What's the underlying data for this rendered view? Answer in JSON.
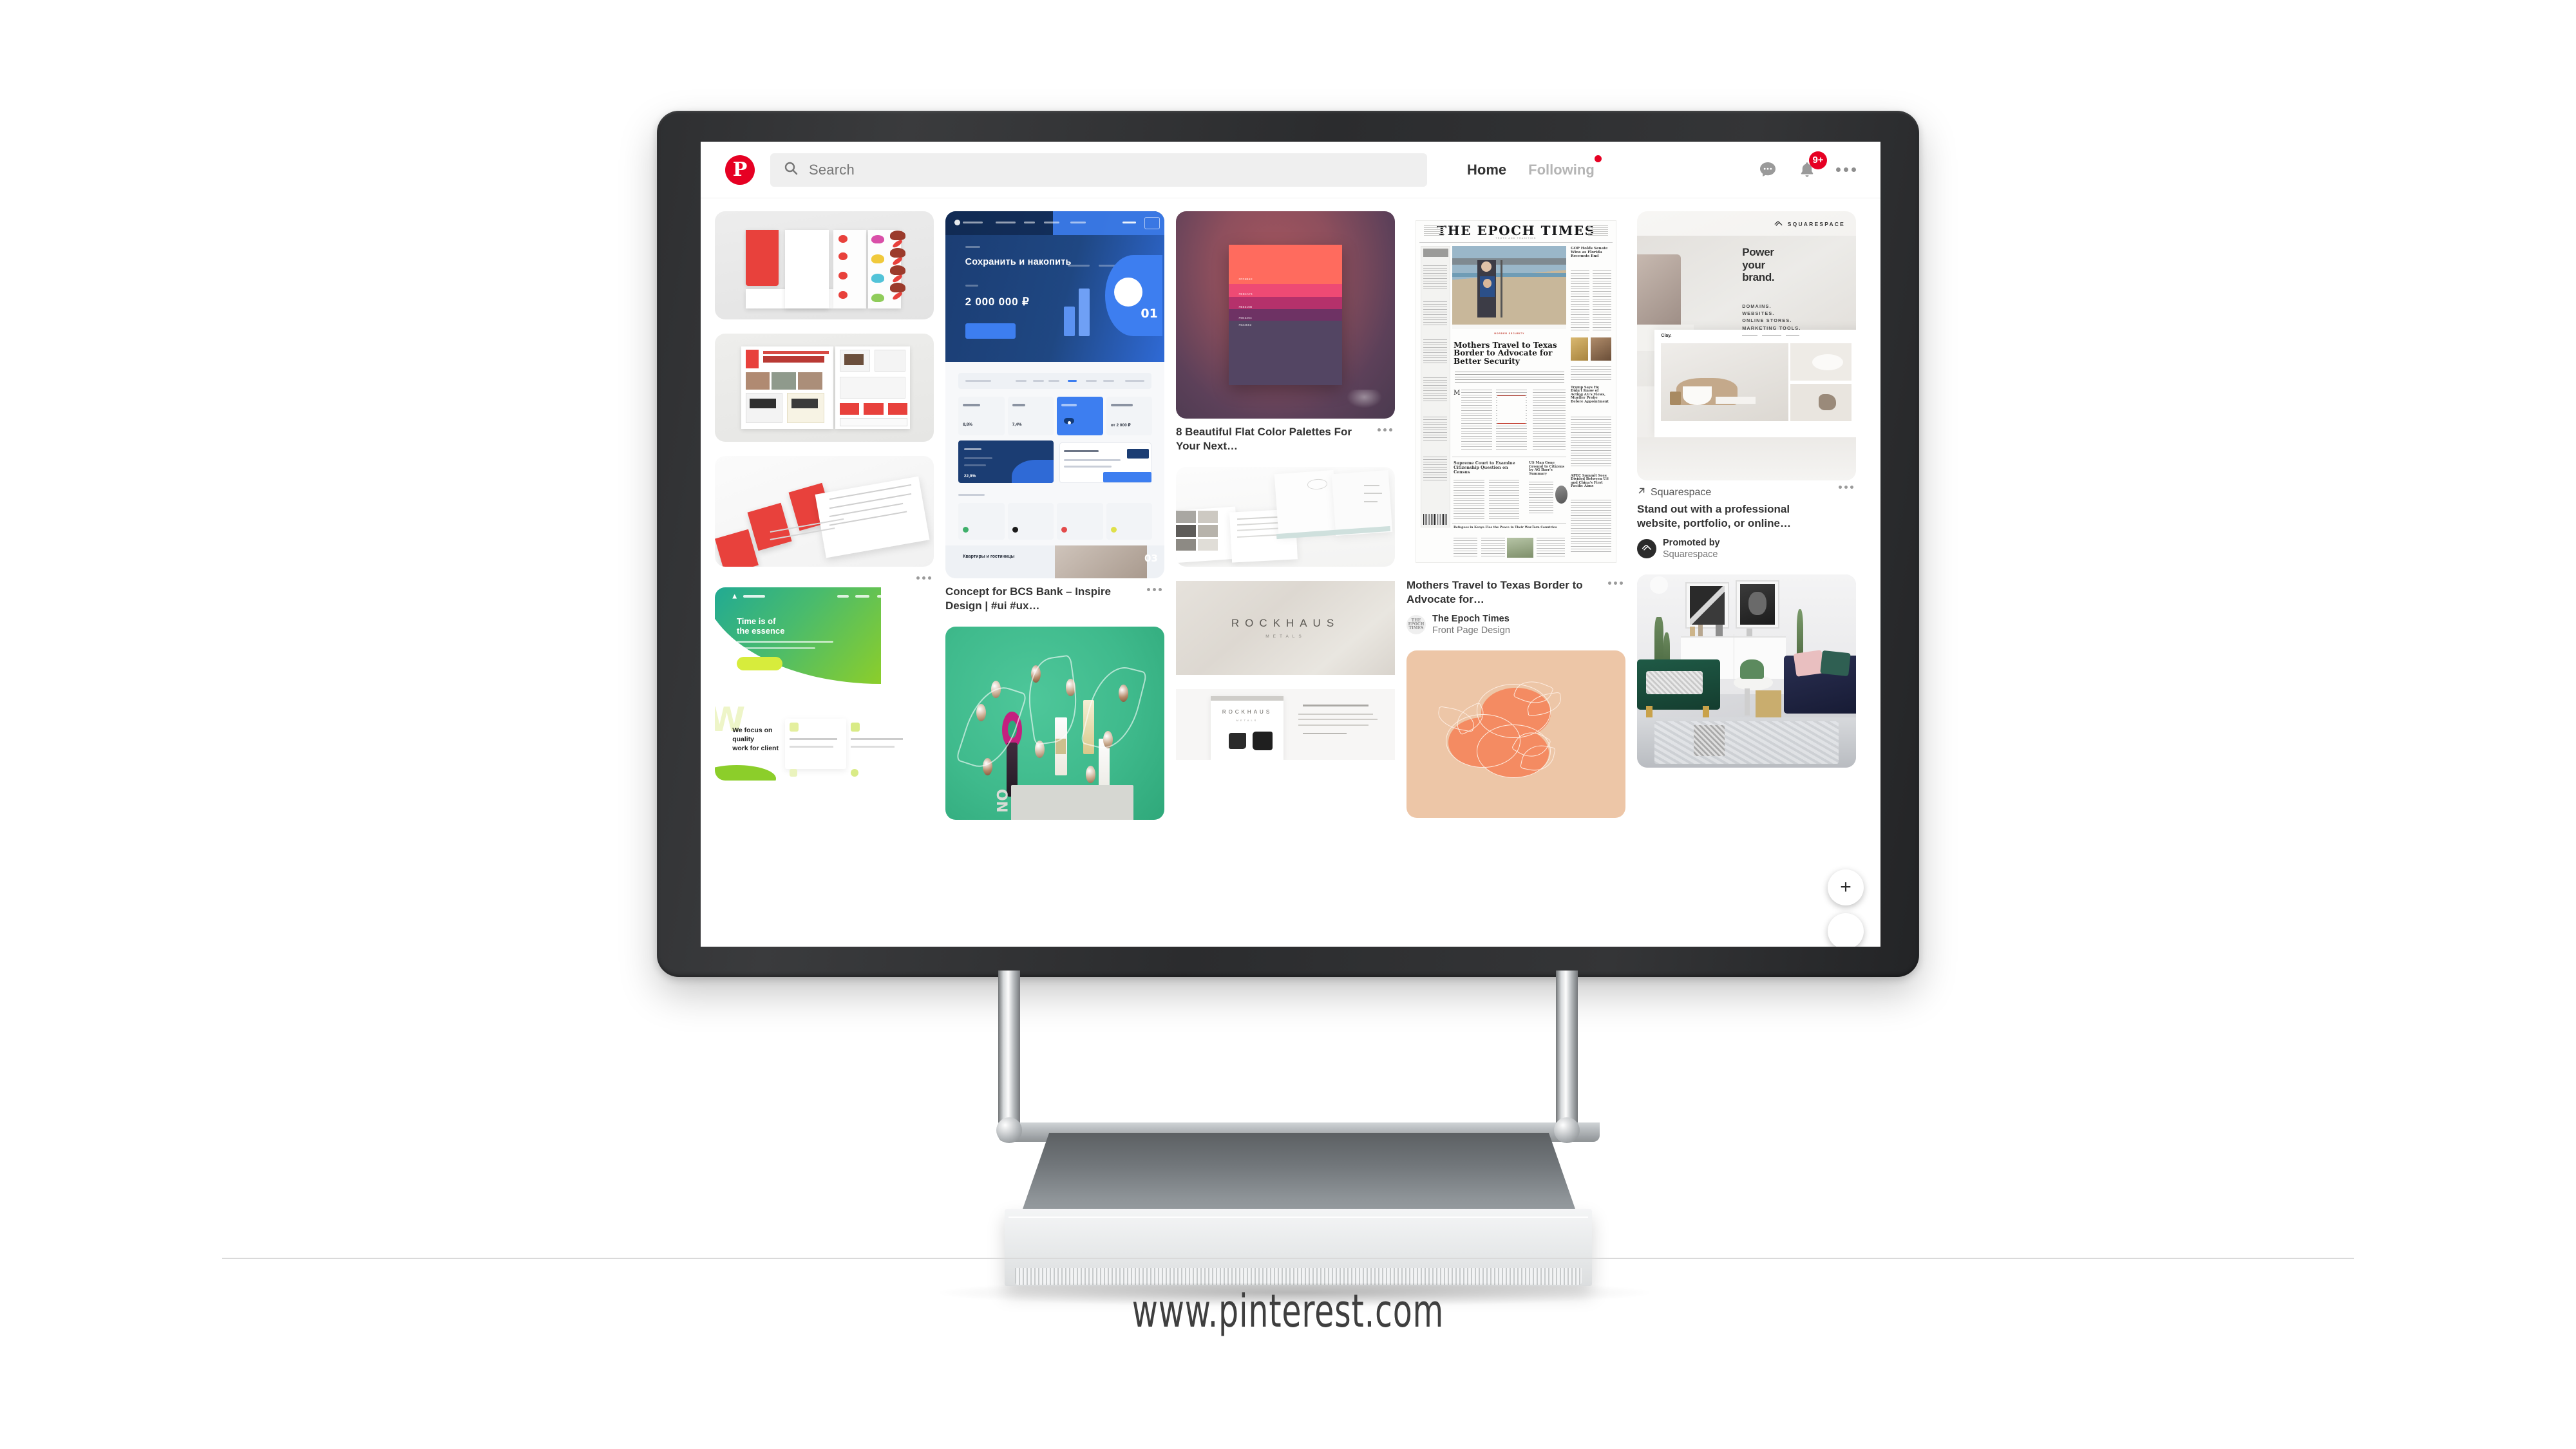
{
  "footer": {
    "url": "www.pinterest.com"
  },
  "browser": {
    "header": {
      "logo_icon": "pinterest-logo-icon",
      "logo_glyph": "P",
      "search": {
        "icon": "search-icon",
        "placeholder": "Search",
        "value": ""
      },
      "nav": [
        {
          "label": "Home",
          "active": true,
          "badge": false
        },
        {
          "label": "Following",
          "active": false,
          "badge": true
        }
      ],
      "actions": [
        {
          "name": "messages-icon",
          "label": "Messages",
          "badge": ""
        },
        {
          "name": "notifications-bell-icon",
          "label": "Notifications",
          "badge": "9+"
        },
        {
          "name": "more-options-icon",
          "label": "More",
          "badge": ""
        }
      ]
    },
    "fabs": [
      {
        "name": "add-pin-fab",
        "glyph": "+"
      },
      {
        "name": "secondary-fab",
        "glyph": ""
      }
    ],
    "feed": {
      "columns": [
        {
          "pins": [
            {
              "id": "matsu-red-family-1",
              "art": "jp-brochure-spread",
              "title": "",
              "kebab": false
            },
            {
              "id": "matsu-red-family-2",
              "art": "jp-brochure-open",
              "title": "",
              "kebab": false
            },
            {
              "id": "matsu-red-family-3",
              "art": "jp-cards-scatter",
              "title": "",
              "kebab": true
            },
            {
              "id": "green-agency-site",
              "art": "agency-green-landing",
              "hero_line1": "Time is of",
              "hero_line2": "the essence",
              "sub_line1": "We focus on",
              "sub_line2": "quality",
              "sub_line3": "work for client",
              "title": "",
              "kebab": false
            }
          ]
        },
        {
          "pins": [
            {
              "id": "bcs-bank-concept",
              "art": "bcs-bank-ui",
              "hero_label": "Сохранить и накопить",
              "hero_amount": "2 000 000 ₽",
              "hero_num": "01",
              "section_num": "03",
              "dates": [
                "28.08",
                "26.08",
                "08.07"
              ],
              "rates": [
                "8,8%",
                "7,4%",
                "от 2 000 ₽",
                "22,9%"
              ],
              "card_title": "Квартиры и гостиницы",
              "title": "Concept for BCS Bank – Inspire Design | #ui #ux…",
              "kebab": true
            },
            {
              "id": "mint-cosmetics-flatlay",
              "art": "mint-flatlay",
              "title": "",
              "kebab": false
            }
          ]
        },
        {
          "pins": [
            {
              "id": "flat-color-palettes",
              "art": "color-palette-card",
              "swatches": [
                "#ff6b5e",
                "#ee4a74",
                "#b5316b",
                "#6e3264",
                "#534563"
              ],
              "hex_labels": [
                "#FF6B5E",
                "#EE4A74",
                "#B5316B",
                "#6E3264",
                "#534563"
              ],
              "title": "8 Beautiful Flat Color Palettes For Your Next…",
              "kebab": true
            },
            {
              "id": "rockhaus-metals-1",
              "art": "rockhaus-brochure",
              "title": "",
              "kebab": false
            },
            {
              "id": "rockhaus-metals-2",
              "art": "rockhaus-logo-plate",
              "brand": "ROCKHAUS",
              "brand_sub": "METALS",
              "title": "",
              "kebab": false
            },
            {
              "id": "rockhaus-metals-3",
              "art": "rockhaus-stationery",
              "brand": "ROCKHAUS",
              "brand_sub": "METALS",
              "title": "",
              "kebab": false
            }
          ]
        },
        {
          "pins": [
            {
              "id": "epoch-times-front-page",
              "art": "newspaper-front-page",
              "masthead": "THE EPOCH TIMES",
              "kicker": "BORDER SECURITY",
              "headline": "Mothers Travel to Texas Border to Advocate for Better Security",
              "title": "Mothers Travel to Texas Border to Advocate for…",
              "kebab": true,
              "attribution": {
                "avatar_icon": "epoch-times-avatar",
                "avatar_text": "THE EPOCH TIMES",
                "name": "The Epoch Times",
                "sub": "Front Page Design"
              }
            },
            {
              "id": "peach-illustration",
              "art": "peach-line-art",
              "title": "",
              "kebab": false
            }
          ]
        },
        {
          "pins": [
            {
              "id": "squarespace-promoted",
              "art": "squarespace-ad",
              "brand_logo": "squarespace-logo-icon",
              "brand_name": "SQUARESPACE",
              "ad_heading_lines": [
                "Power",
                "your",
                "brand."
              ],
              "ad_bullets": [
                "DOMAINS.",
                "WEBSITES.",
                "ONLINE STORES.",
                "MARKETING TOOLS."
              ],
              "source_icon": "external-link-icon",
              "source": "Squarespace",
              "title": "Stand out with a professional website, portfolio, or online…",
              "kebab": true,
              "attribution": {
                "avatar_icon": "squarespace-avatar",
                "name": "Promoted by",
                "sub": "Squarespace"
              }
            },
            {
              "id": "interior-room",
              "art": "interior-living-room",
              "title": "",
              "kebab": false
            }
          ]
        }
      ]
    }
  },
  "colors": {
    "brand_red": "#e60023",
    "text_dark": "#333333",
    "text_muted": "#767676",
    "search_bg": "#efefef",
    "bezel": "#2f3032"
  }
}
